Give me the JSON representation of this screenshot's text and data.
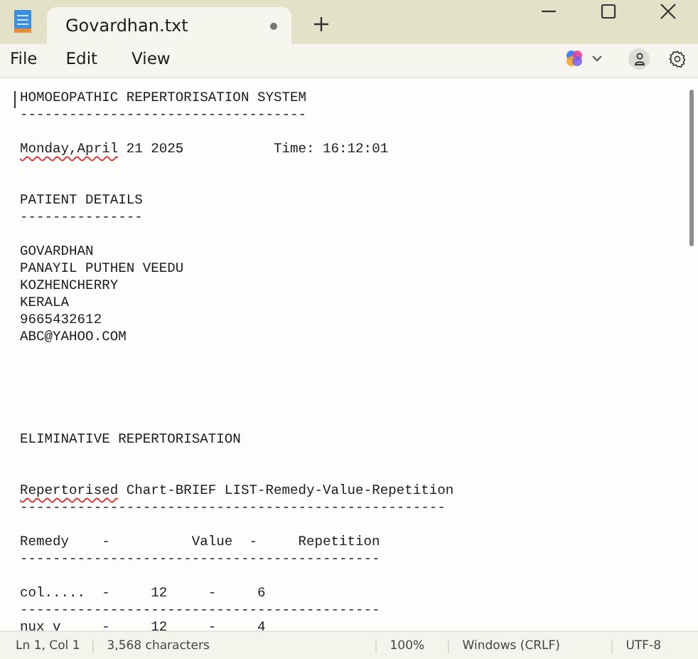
{
  "window": {
    "tab_title": "Govardhan.txt",
    "unsaved": true
  },
  "menu": [
    "File",
    "Edit",
    "View"
  ],
  "document": {
    "lines": [
      {
        "kind": "text",
        "segments": [
          {
            "text": "HOMOEOPATHIC REPERTORISATION SYSTEM",
            "misspelled": false
          }
        ]
      },
      {
        "kind": "text",
        "segments": [
          {
            "text": "-----------------------------------",
            "misspelled": false
          }
        ]
      },
      {
        "kind": "blank"
      },
      {
        "kind": "text",
        "segments": [
          {
            "text": "Monday,April",
            "misspelled": true
          },
          {
            "text": " 21 2025           Time: 16:12:01",
            "misspelled": false
          }
        ]
      },
      {
        "kind": "blank"
      },
      {
        "kind": "blank"
      },
      {
        "kind": "text",
        "segments": [
          {
            "text": "PATIENT DETAILS",
            "misspelled": false
          }
        ]
      },
      {
        "kind": "text",
        "segments": [
          {
            "text": "---------------",
            "misspelled": false
          }
        ]
      },
      {
        "kind": "blank"
      },
      {
        "kind": "text",
        "segments": [
          {
            "text": "GOVARDHAN",
            "misspelled": false
          }
        ]
      },
      {
        "kind": "text",
        "segments": [
          {
            "text": "PANAYIL PUTHEN VEEDU",
            "misspelled": false
          }
        ]
      },
      {
        "kind": "text",
        "segments": [
          {
            "text": "KOZHENCHERRY",
            "misspelled": false
          }
        ]
      },
      {
        "kind": "text",
        "segments": [
          {
            "text": "KERALA",
            "misspelled": false
          }
        ]
      },
      {
        "kind": "text",
        "segments": [
          {
            "text": "9665432612",
            "misspelled": false
          }
        ]
      },
      {
        "kind": "text",
        "segments": [
          {
            "text": "ABC@YAHOO.COM",
            "misspelled": false
          }
        ]
      },
      {
        "kind": "blank"
      },
      {
        "kind": "blank"
      },
      {
        "kind": "blank"
      },
      {
        "kind": "blank"
      },
      {
        "kind": "blank"
      },
      {
        "kind": "text",
        "segments": [
          {
            "text": "ELIMINATIVE REPERTORISATION",
            "misspelled": false
          }
        ]
      },
      {
        "kind": "blank"
      },
      {
        "kind": "blank"
      },
      {
        "kind": "text",
        "segments": [
          {
            "text": "Repertorised",
            "misspelled": true
          },
          {
            "text": " Chart-BRIEF LIST-Remedy-Value-Repetition",
            "misspelled": false
          }
        ]
      },
      {
        "kind": "text",
        "segments": [
          {
            "text": "----------------------------------------------------",
            "misspelled": false
          }
        ]
      },
      {
        "kind": "blank"
      },
      {
        "kind": "text",
        "segments": [
          {
            "text": "Remedy    -          Value  -     Repetition",
            "misspelled": false
          }
        ]
      },
      {
        "kind": "text",
        "segments": [
          {
            "text": "--------------------------------------------",
            "misspelled": false
          }
        ]
      },
      {
        "kind": "blank"
      },
      {
        "kind": "text",
        "segments": [
          {
            "text": "col.....  -     12     -     6",
            "misspelled": false
          }
        ]
      },
      {
        "kind": "text",
        "segments": [
          {
            "text": "--------------------------------------------",
            "misspelled": false
          }
        ]
      },
      {
        "kind": "text",
        "segments": [
          {
            "text": "nux v     -     12     -     4",
            "misspelled": false
          }
        ]
      }
    ]
  },
  "status_bar": {
    "position": "Ln 1, Col 1",
    "characters": "3,568 characters",
    "zoom": "100%",
    "line_ending": "Windows (CRLF)",
    "encoding": "UTF-8"
  }
}
